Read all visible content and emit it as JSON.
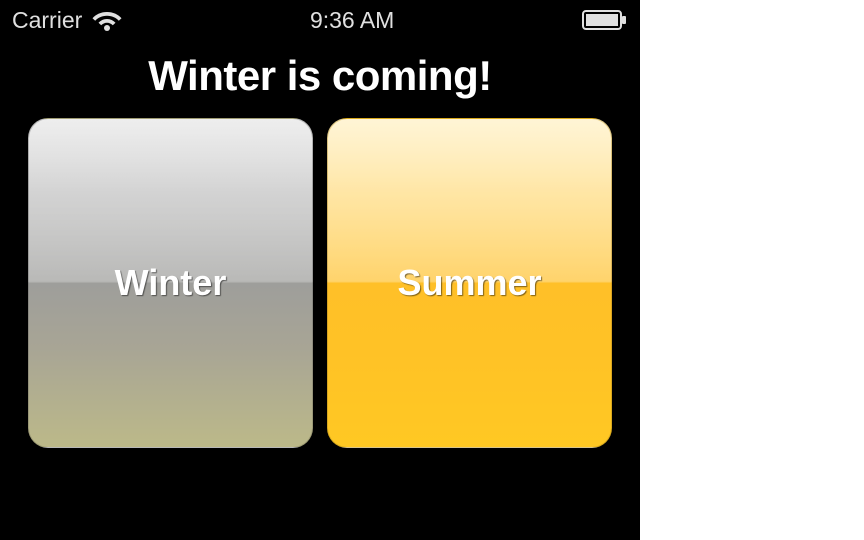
{
  "statusBar": {
    "carrier": "Carrier",
    "time": "9:36 AM"
  },
  "title": "Winter is coming!",
  "buttons": {
    "winter": {
      "label": "Winter"
    },
    "summer": {
      "label": "Summer"
    }
  }
}
